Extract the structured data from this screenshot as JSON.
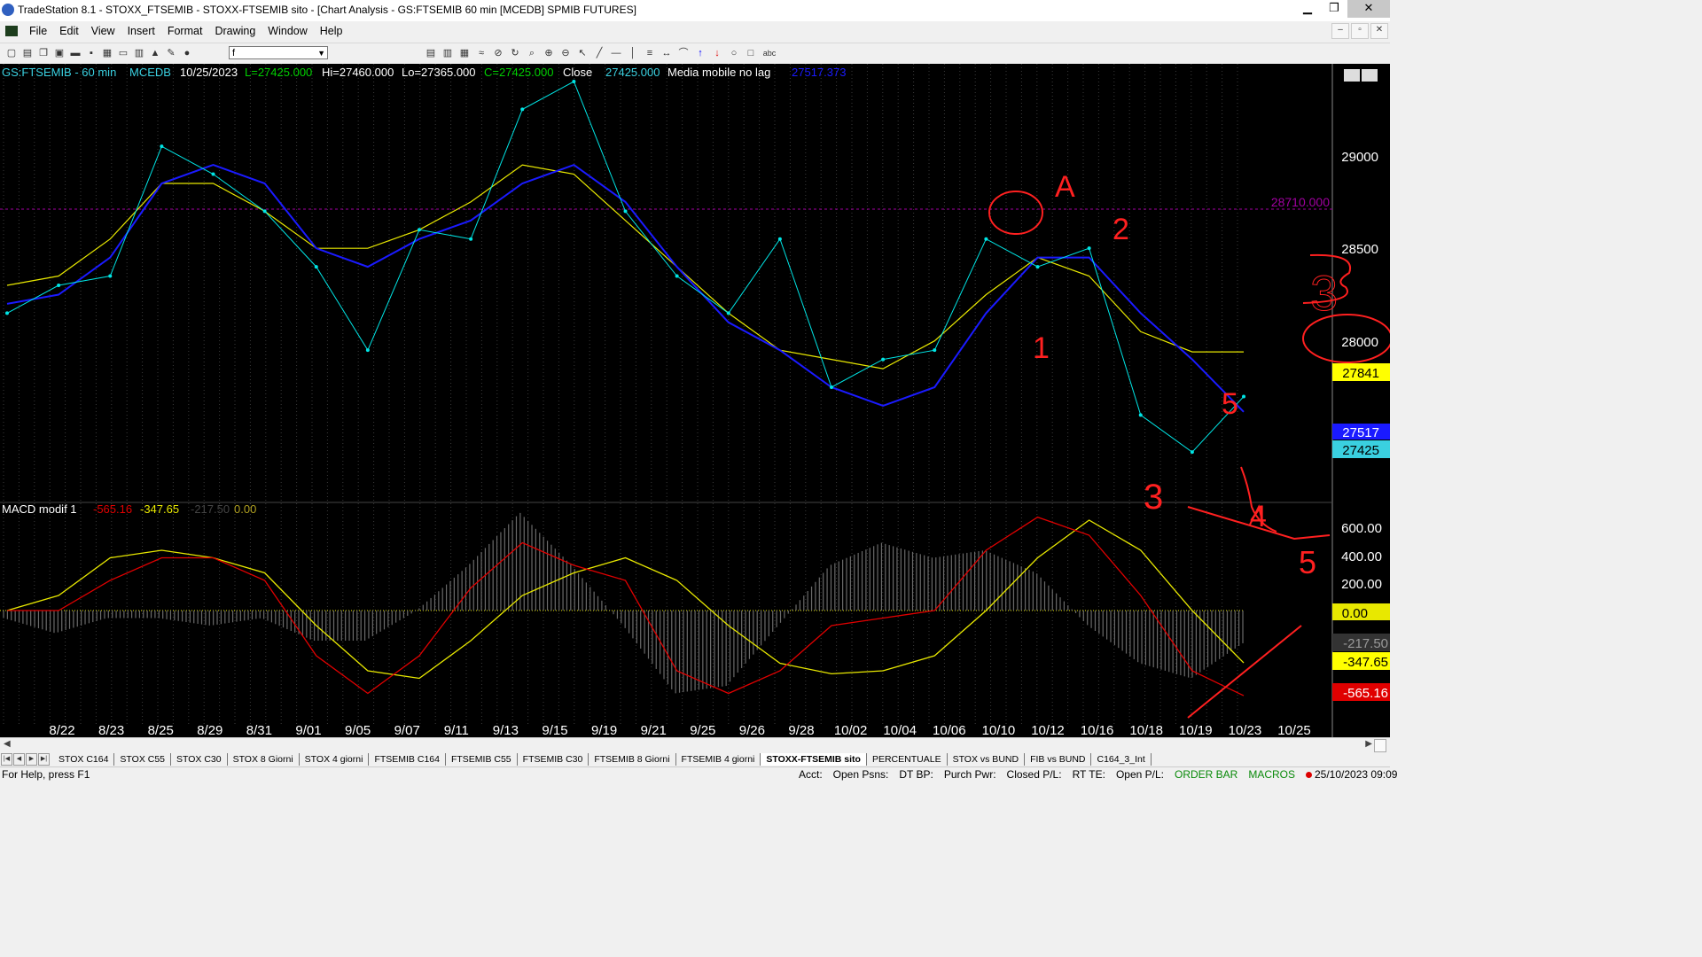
{
  "window": {
    "title": "TradeStation 8.1 - STOXX_FTSEMIB - STOXX-FTSEMIB sito - [Chart Analysis - GS:FTSEMIB  60 min  [MCEDB] SPMIB FUTURES]",
    "buttons": {
      "minimize": "▁",
      "restore": "❐",
      "close": "✕"
    }
  },
  "menu": [
    "File",
    "Edit",
    "View",
    "Insert",
    "Format",
    "Drawing",
    "Window",
    "Help"
  ],
  "mdi_buttons": [
    "–",
    "▫",
    "✕"
  ],
  "toolbar": {
    "symbol_combo": "f"
  },
  "price_panel": {
    "symbol": "GS:FTSEMIB - 60 min",
    "exchange": "MCEDB",
    "date": "10/25/2023",
    "low_label": "L=27425.000",
    "hi_label": "Hi=27460.000",
    "lo_label": "Lo=27365.000",
    "close_label": "C=27425.000",
    "close_word": "Close",
    "close_value": "27425.000",
    "indicator_name": "Media mobile no lag",
    "indicator_value": "27517.373",
    "hline_label": "28710.000",
    "axis_labels": [
      "29000",
      "28500",
      "28000"
    ],
    "tags": {
      "yellow": "27841",
      "blue": "27517",
      "price": "27425"
    }
  },
  "macd_panel": {
    "name": "MACD modif 1",
    "v1": "-565.16",
    "v2": "-347.65",
    "v3": "-217.50",
    "v4": "0.00",
    "axis_labels": [
      "600.00",
      "400.00",
      "200.00"
    ],
    "tags": {
      "zero": "0.00",
      "hist": "-217.50",
      "signal": "-347.65",
      "macd": "-565.16"
    }
  },
  "x_axis": [
    "8/22",
    "8/23",
    "8/25",
    "8/29",
    "8/31",
    "9/01",
    "9/05",
    "9/07",
    "9/11",
    "9/13",
    "9/15",
    "9/19",
    "9/21",
    "9/25",
    "9/26",
    "9/28",
    "10/02",
    "10/04",
    "10/06",
    "10/10",
    "10/12",
    "10/16",
    "10/18",
    "10/19",
    "10/23",
    "10/25"
  ],
  "annotations": {
    "a": "A",
    "n2": "2",
    "n3_right": "3",
    "n1": "1",
    "n3_low": "3",
    "n5_top": "5",
    "n4": "4",
    "n5_low": "5"
  },
  "tabs": [
    "STOX C164",
    "STOX C55",
    "STOX C30",
    "STOX 8 Giorni",
    "STOX 4 giorni",
    "FTSEMIB C164",
    "FTSEMIB C55",
    "FTSEMIB C30",
    "FTSEMIB 8 Giorni",
    "FTSEMIB 4 giorni",
    "STOXX-FTSEMIB sito",
    "PERCENTUALE",
    "STOX vs BUND",
    "FIB vs BUND",
    "C164_3_Int"
  ],
  "active_tab": "STOXX-FTSEMIB sito",
  "status": {
    "help": "For Help, press F1",
    "acct": "Acct:",
    "open_psns": "Open Psns:",
    "dt_bp": "DT BP:",
    "purch_pwr": "Purch Pwr:",
    "closed_pl": "Closed P/L:",
    "rt_te": "RT TE:",
    "open_pl": "Open P/L:",
    "order_bar": "ORDER BAR",
    "macros": "MACROS",
    "datetime": "25/10/2023 09:09"
  },
  "colors": {
    "price": "#00e5e5",
    "mma_blue": "#1a1aff",
    "mma_yellow": "#e8e800",
    "macd_red": "#e00000",
    "hline": "#a000a0",
    "annot": "#ff2020"
  },
  "chart_data": [
    {
      "type": "line",
      "title": "GS:FTSEMIB - 60 min",
      "x": [
        "8/22",
        "8/23",
        "8/25",
        "8/29",
        "8/31",
        "9/01",
        "9/05",
        "9/07",
        "9/11",
        "9/13",
        "9/15",
        "9/19",
        "9/21",
        "9/25",
        "9/26",
        "9/28",
        "10/02",
        "10/04",
        "10/06",
        "10/10",
        "10/12",
        "10/16",
        "10/18",
        "10/19",
        "10/23",
        "10/25"
      ],
      "ylim": [
        27100,
        29300
      ],
      "series": [
        {
          "name": "GS:FTSEMIB",
          "values": [
            28050,
            28200,
            28250,
            28950,
            28800,
            28600,
            28300,
            27850,
            28500,
            28450,
            29150,
            29300,
            28600,
            28250,
            28050,
            28450,
            27650,
            27800,
            27850,
            28450,
            28300,
            28400,
            27500,
            27300,
            27600
          ]
        },
        {
          "name": "Media mobile no lag",
          "values": [
            28100,
            28150,
            28350,
            28750,
            28850,
            28750,
            28400,
            28300,
            28450,
            28550,
            28750,
            28850,
            28650,
            28300,
            28000,
            27850,
            27650,
            27550,
            27650,
            28050,
            28350,
            28350,
            28050,
            27800,
            27517
          ]
        },
        {
          "values": [
            28200,
            28250,
            28450,
            28750,
            28750,
            28600,
            28400,
            28400,
            28500,
            28650,
            28850,
            28800,
            28550,
            28300,
            28050,
            27850,
            27800,
            27750,
            27900,
            28150,
            28350,
            28250,
            27950,
            27841,
            27841
          ]
        }
      ],
      "hlines": [
        28710
      ]
    },
    {
      "type": "line",
      "title": "MACD modif 1",
      "x": [
        "8/22",
        "8/23",
        "8/25",
        "8/29",
        "8/31",
        "9/01",
        "9/05",
        "9/07",
        "9/11",
        "9/13",
        "9/15",
        "9/19",
        "9/21",
        "9/25",
        "9/26",
        "9/28",
        "10/02",
        "10/04",
        "10/06",
        "10/10",
        "10/12",
        "10/16",
        "10/18",
        "10/19",
        "10/23",
        "10/25"
      ],
      "ylim": [
        -760,
        700
      ],
      "series": [
        {
          "name": "MACD",
          "values": [
            0,
            0,
            200,
            350,
            350,
            200,
            -300,
            -550,
            -300,
            150,
            450,
            300,
            200,
            -400,
            -550,
            -400,
            -100,
            -50,
            0,
            400,
            620,
            500,
            100,
            -400,
            -565.16
          ]
        },
        {
          "name": "Signal",
          "values": [
            0,
            100,
            350,
            400,
            350,
            250,
            -100,
            -400,
            -450,
            -200,
            100,
            250,
            350,
            200,
            -100,
            -350,
            -420,
            -400,
            -300,
            0,
            350,
            600,
            400,
            0,
            -347.65
          ]
        },
        {
          "name": "Histogram",
          "values": [
            -50,
            -150,
            -50,
            -50,
            -100,
            -50,
            -200,
            -200,
            0,
            300,
            650,
            300,
            -100,
            -550,
            -500,
            -100,
            300,
            450,
            350,
            400,
            250,
            -100,
            -350,
            -450,
            -217.5
          ]
        }
      ]
    }
  ]
}
